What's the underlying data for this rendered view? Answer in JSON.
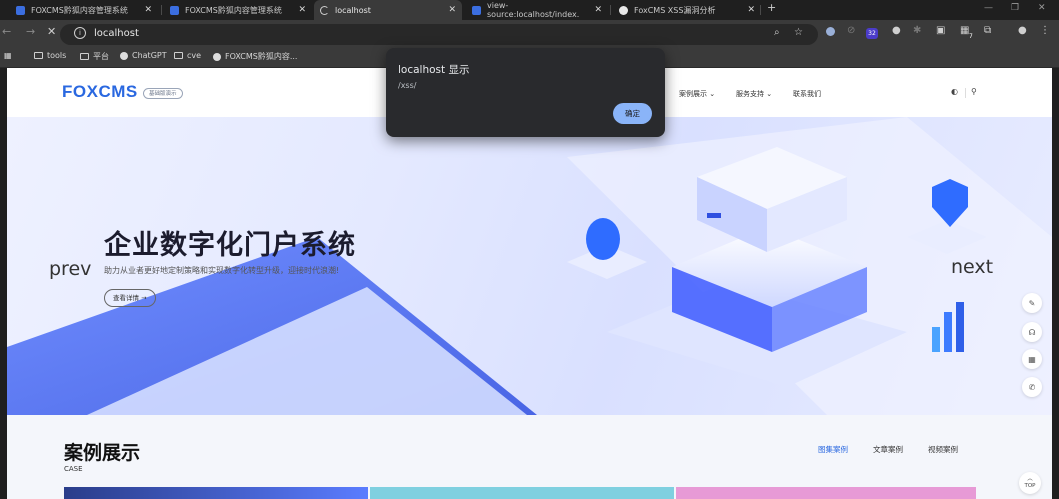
{
  "browser": {
    "tabs": [
      {
        "title": "FOXCMS黔狐内容管理系统",
        "active": false
      },
      {
        "title": "FOXCMS黔狐内容管理系统",
        "active": false
      },
      {
        "title": "localhost",
        "active": true
      },
      {
        "title": "view-source:localhost/index.",
        "active": false
      },
      {
        "title": "FoxCMS XSS漏洞分析",
        "active": false
      }
    ],
    "new_tab": "+",
    "address": "localhost",
    "bookmarks": [
      "tools",
      "平台",
      "ChatGPT",
      "cve",
      "FOXCMS黔狐内容..."
    ],
    "extension_badges": {
      "a": "32",
      "b": "7"
    }
  },
  "site": {
    "logo": "FOXCMS",
    "logo_badge": "基础版演示",
    "nav": [
      "案例展示 ⌄",
      "服务支持 ⌄",
      "联系我们"
    ],
    "hero": {
      "title": "企业数字化门户系统",
      "subtitle": "助力从业者更好地定制策略和实现数字化转型升级，迎接时代浪潮!",
      "button": "查看详情 →",
      "prev": "prev",
      "next": "next"
    },
    "cases": {
      "title": "案例展示",
      "subtitle": "CASE",
      "tabs": [
        "图集案例",
        "文章案例",
        "视频案例"
      ]
    },
    "top_button": "TOP"
  },
  "dialog": {
    "title": "localhost 显示",
    "message": "/xss/",
    "ok": "确定"
  },
  "colors": {
    "accent": "#2a68e0",
    "dialog_bg": "#292a2d",
    "dialog_button": "#8ab4f8"
  }
}
